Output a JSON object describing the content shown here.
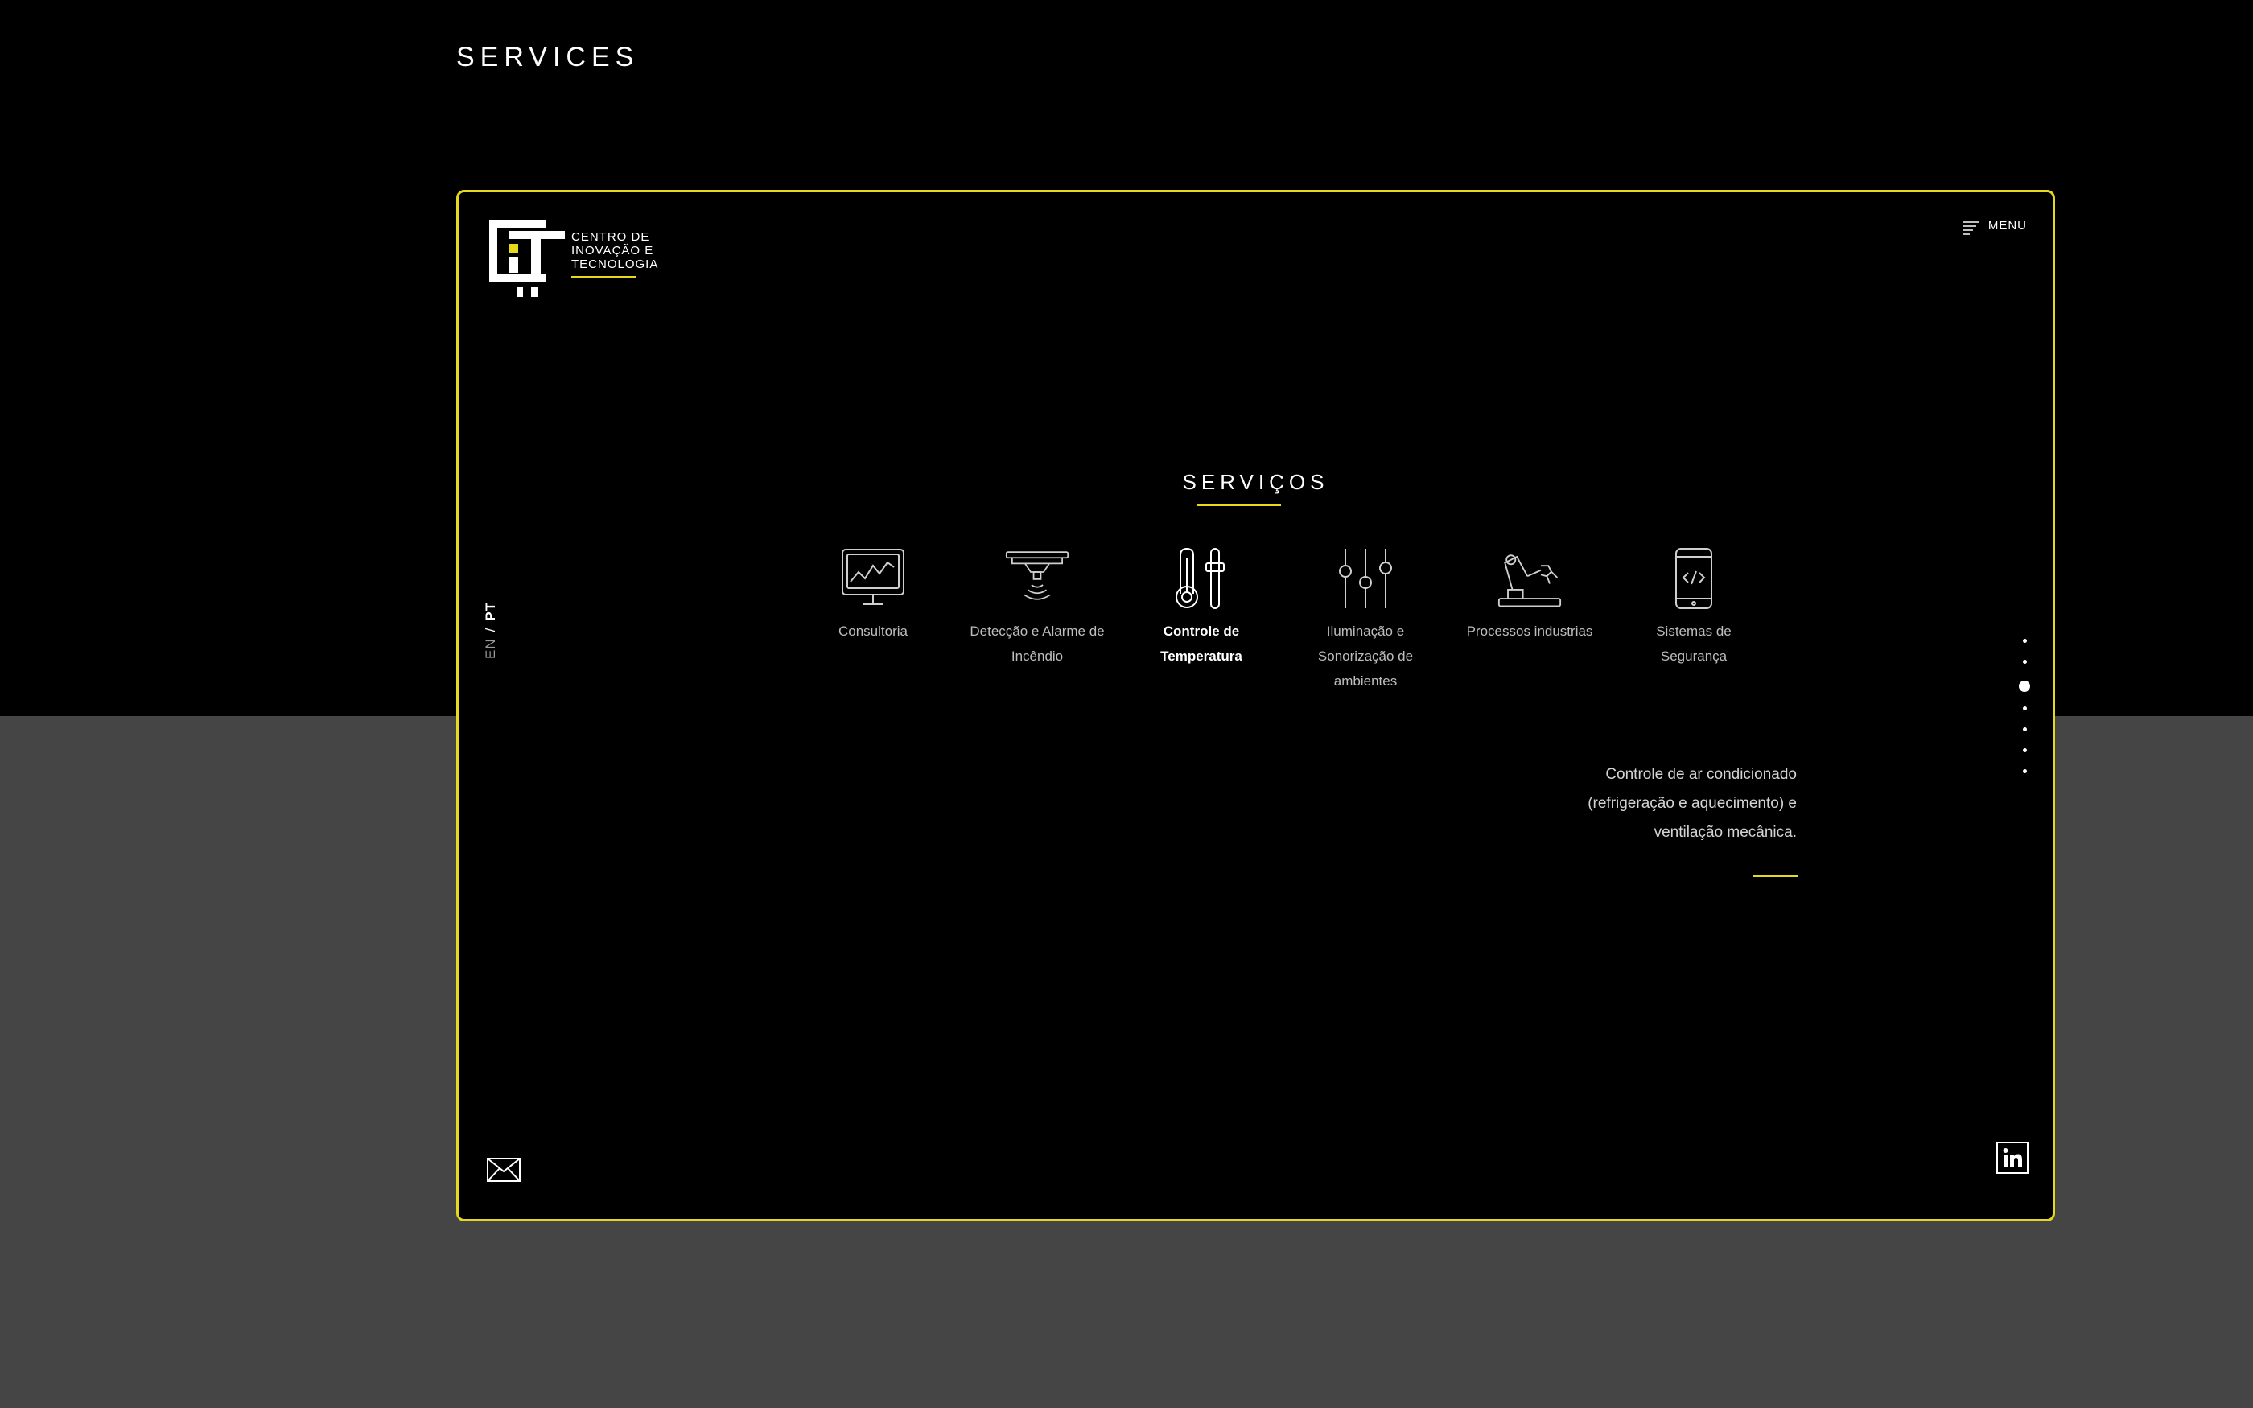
{
  "page": {
    "heading": "SERVICES"
  },
  "colors": {
    "accent": "#e6d81c",
    "frame_bg": "#000000",
    "page_bg_top": "#000000",
    "page_bg_bottom": "#454545"
  },
  "logo": {
    "lines": [
      "CENTRO DE",
      "INOVAÇÃO E",
      "TECNOLOGIA"
    ]
  },
  "menu": {
    "label": "MENU",
    "icon": "hamburger-menu-icon"
  },
  "language": {
    "en": "EN",
    "separator": "/",
    "pt": "PT",
    "selected": "PT"
  },
  "section": {
    "title": "SERVIÇOS"
  },
  "services": [
    {
      "label": "Consultoria",
      "icon": "monitor-chart-icon"
    },
    {
      "label": "Detecção e Alarme de Incêndio",
      "icon": "smoke-detector-icon"
    },
    {
      "label": "Controle de Temperatura",
      "icon": "thermometer-icon",
      "active": true
    },
    {
      "label": "Iluminação e Sonorização de ambientes",
      "icon": "sliders-icon"
    },
    {
      "label": "Processos industrias",
      "icon": "robot-arm-icon"
    },
    {
      "label": "Sistemas de Segurança",
      "icon": "smartphone-code-icon"
    }
  ],
  "description": "Controle de ar condicionado (refrigeração e aquecimento) e ventilação mecânica.",
  "pagination": {
    "total": 7,
    "current": 3
  },
  "footer": {
    "mail_icon": "envelope-icon",
    "linkedin_icon": "linkedin-icon"
  }
}
